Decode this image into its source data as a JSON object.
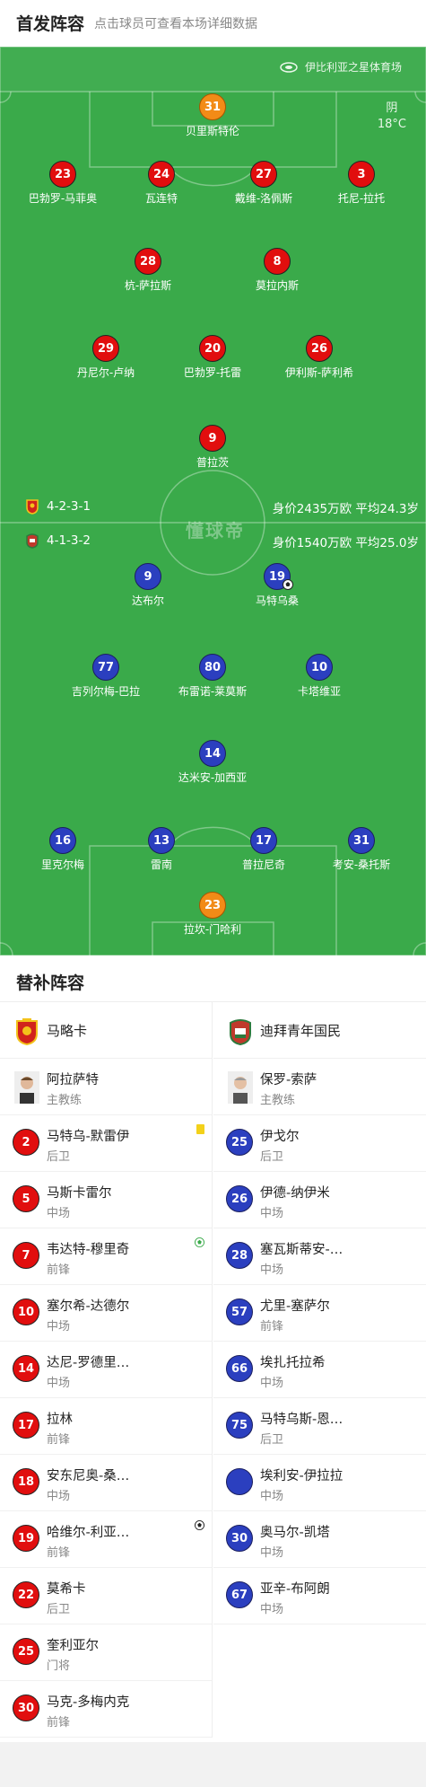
{
  "header": {
    "title": "首发阵容",
    "subtitle": "点击球员可查看本场详细数据"
  },
  "pitch": {
    "stadium": "伊比利亚之星体育场",
    "weather": {
      "condition": "阴",
      "temp": "18°C"
    },
    "watermark": "懂球帝",
    "home": {
      "formation": "4-2-3-1",
      "value": "身价2435万欧 平均24.3岁"
    },
    "away": {
      "formation": "4-1-3-2",
      "value": "身价1540万欧 平均25.0岁"
    },
    "home_players": [
      {
        "num": "31",
        "name": "贝里斯特伦",
        "gk": true
      },
      {
        "num": "23",
        "name": "巴勃罗-马菲奥"
      },
      {
        "num": "24",
        "name": "瓦连特"
      },
      {
        "num": "27",
        "name": "戴维-洛佩斯"
      },
      {
        "num": "3",
        "name": "托尼-拉托"
      },
      {
        "num": "28",
        "name": "杭-萨拉斯"
      },
      {
        "num": "8",
        "name": "莫拉内斯"
      },
      {
        "num": "29",
        "name": "丹尼尔-卢纳"
      },
      {
        "num": "20",
        "name": "巴勃罗-托雷"
      },
      {
        "num": "26",
        "name": "伊利斯-萨利希"
      },
      {
        "num": "9",
        "name": "普拉茨"
      }
    ],
    "away_players": [
      {
        "num": "9",
        "name": "达布尔"
      },
      {
        "num": "19",
        "name": "马特乌桑"
      },
      {
        "num": "77",
        "name": "吉列尔梅-巴拉"
      },
      {
        "num": "80",
        "name": "布雷诺-莱莫斯"
      },
      {
        "num": "10",
        "name": "卡塔维亚"
      },
      {
        "num": "14",
        "name": "达米安-加西亚"
      },
      {
        "num": "16",
        "name": "里克尔梅"
      },
      {
        "num": "13",
        "name": "雷南"
      },
      {
        "num": "17",
        "name": "普拉尼奇"
      },
      {
        "num": "31",
        "name": "考安-桑托斯"
      },
      {
        "num": "23",
        "name": "拉坎-门哈利",
        "gk": true
      }
    ]
  },
  "subs": {
    "title": "替补阵容",
    "home": {
      "team": "马略卡",
      "coach": {
        "name": "阿拉萨特",
        "role": "主教练"
      },
      "players": [
        {
          "num": "2",
          "name": "马特乌-默雷伊",
          "pos": "后卫",
          "event": "yellow-card"
        },
        {
          "num": "5",
          "name": "马斯卡雷尔",
          "pos": "中场"
        },
        {
          "num": "7",
          "name": "韦达特-穆里奇",
          "pos": "前锋",
          "event": "goal"
        },
        {
          "num": "10",
          "name": "塞尔希-达德尔",
          "pos": "中场"
        },
        {
          "num": "14",
          "name": "达尼-罗德里…",
          "pos": "中场"
        },
        {
          "num": "17",
          "name": "拉林",
          "pos": "前锋"
        },
        {
          "num": "18",
          "name": "安东尼奥-桑…",
          "pos": "中场"
        },
        {
          "num": "19",
          "name": "哈维尔-利亚…",
          "pos": "前锋",
          "event": "goal-black"
        },
        {
          "num": "22",
          "name": "莫希卡",
          "pos": "后卫"
        },
        {
          "num": "25",
          "name": "奎利亚尔",
          "pos": "门将"
        },
        {
          "num": "30",
          "name": "马克-多梅内克",
          "pos": "前锋"
        }
      ]
    },
    "away": {
      "team": "迪拜青年国民",
      "coach": {
        "name": "保罗-索萨",
        "role": "主教练"
      },
      "players": [
        {
          "num": "25",
          "name": "伊戈尔",
          "pos": "后卫"
        },
        {
          "num": "26",
          "name": "伊德-纳伊米",
          "pos": "中场"
        },
        {
          "num": "28",
          "name": "塞瓦斯蒂安-…",
          "pos": "中场"
        },
        {
          "num": "57",
          "name": "尤里-塞萨尔",
          "pos": "前锋"
        },
        {
          "num": "66",
          "name": "埃扎托拉希",
          "pos": "中场"
        },
        {
          "num": "75",
          "name": "马特乌斯-恩…",
          "pos": "后卫"
        },
        {
          "num": "",
          "name": "埃利安-伊拉拉",
          "pos": "中场"
        },
        {
          "num": "30",
          "name": "奥马尔-凯塔",
          "pos": "中场"
        },
        {
          "num": "67",
          "name": "亚辛-布阿朗",
          "pos": "中场"
        }
      ]
    }
  }
}
